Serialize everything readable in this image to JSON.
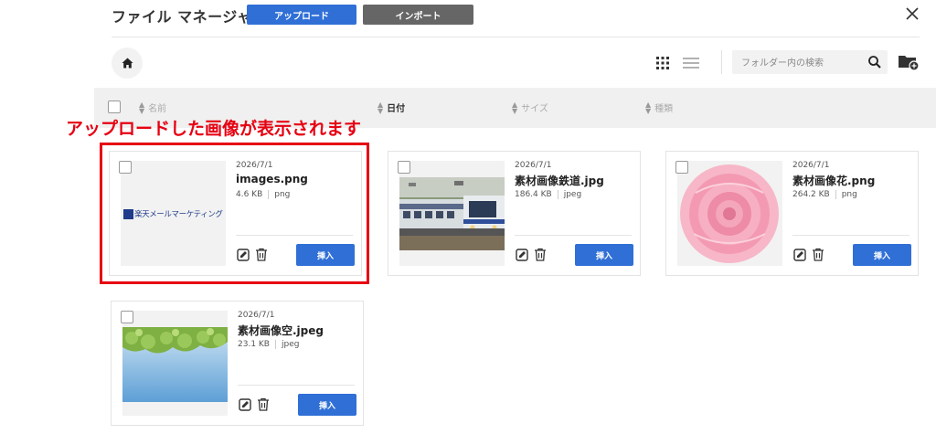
{
  "header": {
    "title": "ファイル マネージャ",
    "upload_label": "アップロード",
    "import_label": "インポート"
  },
  "toolbar": {
    "search_placeholder": "フォルダー内の検索"
  },
  "columns": [
    {
      "label": "名前",
      "active": false
    },
    {
      "label": "日付",
      "active": true
    },
    {
      "label": "サイズ",
      "active": false
    },
    {
      "label": "種類",
      "active": false
    }
  ],
  "annotation": "アップロードした画像が表示されます",
  "files": [
    {
      "date": "2026/7/1",
      "name": "images.png",
      "size": "4.6 KB",
      "type": "png",
      "insert_label": "挿入",
      "thumb": "logo",
      "logo_text": "楽天メールマーケティング"
    },
    {
      "date": "2026/7/1",
      "name": "素材画像鉄道.jpg",
      "size": "186.4 KB",
      "type": "jpeg",
      "insert_label": "挿入",
      "thumb": "train"
    },
    {
      "date": "2026/7/1",
      "name": "素材画像花.png",
      "size": "264.2 KB",
      "type": "png",
      "insert_label": "挿入",
      "thumb": "flower"
    },
    {
      "date": "2026/7/1",
      "name": "素材画像空.jpeg",
      "size": "23.1 KB",
      "type": "jpeg",
      "insert_label": "挿入",
      "thumb": "sky"
    }
  ],
  "colors": {
    "primary": "#2f6fd6",
    "secondary": "#666666",
    "annotation": "#e60012"
  }
}
